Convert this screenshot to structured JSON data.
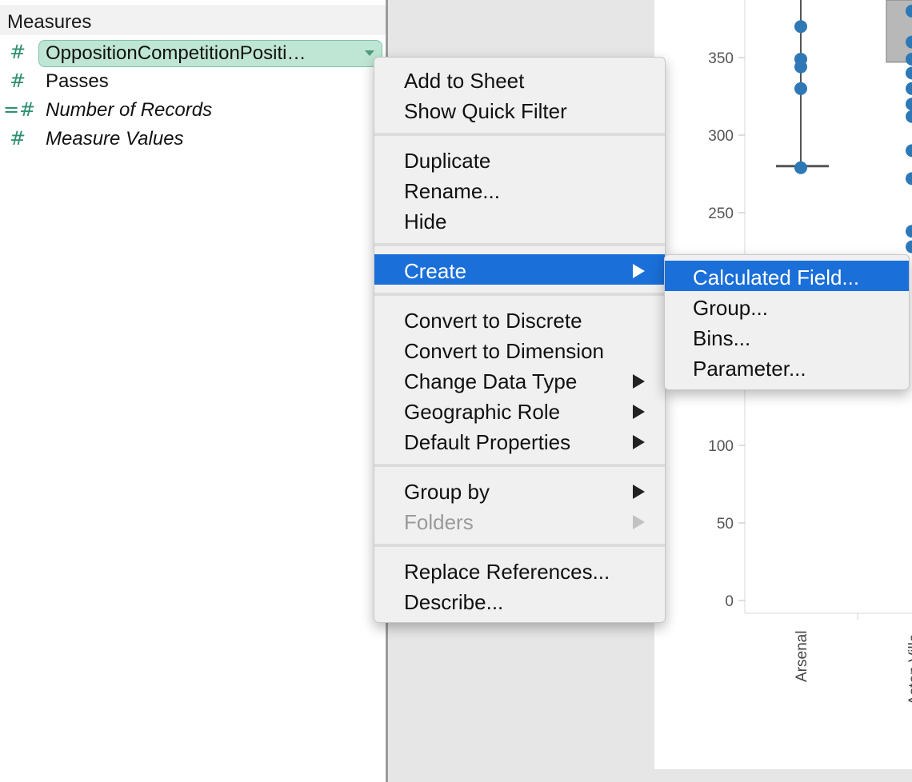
{
  "data_pane": {
    "section_title": "Measures",
    "fields": [
      {
        "name": "OppositionCompetitionPositi…",
        "icon": "number-measure-icon",
        "selected": true
      },
      {
        "name": "Passes",
        "icon": "number-measure-icon"
      },
      {
        "name": "Number of Records",
        "icon": "calculated-measure-icon",
        "italic": true
      },
      {
        "name": "Measure Values",
        "icon": "number-measure-icon",
        "italic": true
      }
    ]
  },
  "context_menu": {
    "groups": [
      [
        {
          "label": "Add to Sheet"
        },
        {
          "label": "Show Quick Filter"
        }
      ],
      [
        {
          "label": "Duplicate"
        },
        {
          "label": "Rename..."
        },
        {
          "label": "Hide"
        }
      ],
      [
        {
          "label": "Create",
          "submenu": true,
          "highlighted": true
        }
      ],
      [
        {
          "label": "Convert to Discrete"
        },
        {
          "label": "Convert to Dimension"
        },
        {
          "label": "Change Data Type",
          "submenu": true
        },
        {
          "label": "Geographic Role",
          "submenu": true
        },
        {
          "label": "Default Properties",
          "submenu": true
        }
      ],
      [
        {
          "label": "Group by",
          "submenu": true
        },
        {
          "label": "Folders",
          "submenu": true,
          "disabled": true
        }
      ],
      [
        {
          "label": "Replace References..."
        },
        {
          "label": "Describe..."
        }
      ]
    ]
  },
  "create_submenu": {
    "items": [
      {
        "label": "Calculated Field...",
        "highlighted": true
      },
      {
        "label": "Group..."
      },
      {
        "label": "Bins..."
      },
      {
        "label": "Parameter..."
      }
    ]
  },
  "chart_data": {
    "type": "scatter",
    "y_ticks": [
      "350",
      "300",
      "250",
      "100",
      "50",
      "0"
    ],
    "y_tick_values": [
      350,
      300,
      250,
      100,
      50,
      0
    ],
    "categories": [
      "Arsenal",
      "Aston Villa"
    ],
    "category_labels": [
      "Arsenal",
      "Aston Villa"
    ],
    "series": [
      {
        "category": "Arsenal",
        "values": [
          370,
          349,
          344,
          330,
          279
        ],
        "median_line": 280
      },
      {
        "category": "Aston Villa",
        "values": [
          380,
          360,
          349,
          340,
          330,
          320,
          312,
          290,
          272,
          238,
          228
        ]
      }
    ],
    "colors": {
      "points": "#2f78b6",
      "whisker": "#555555",
      "box": "#b8b8b8"
    }
  }
}
